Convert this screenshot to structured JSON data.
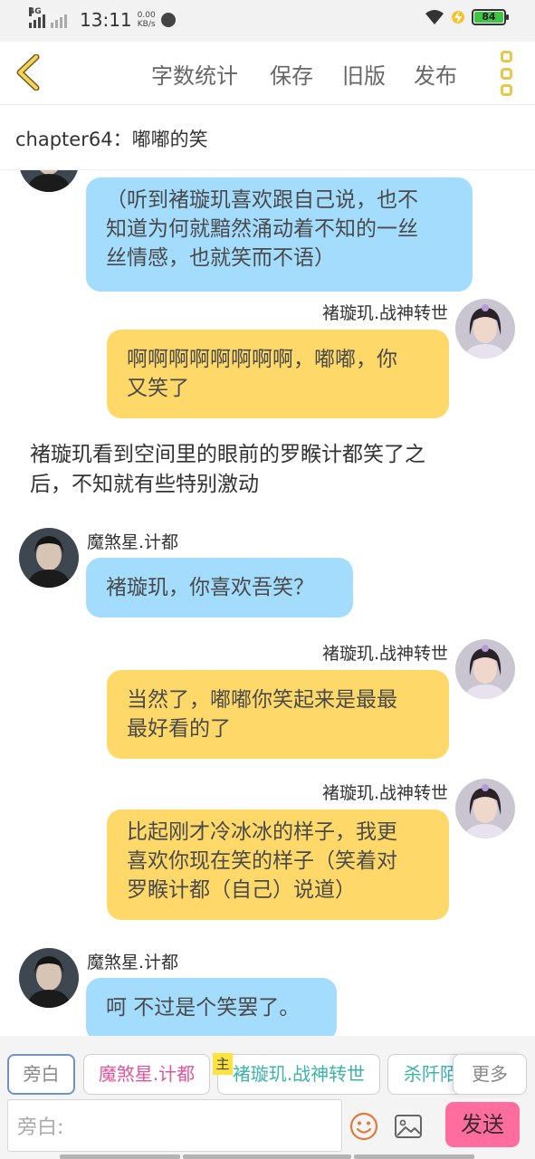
{
  "status_bar": {
    "network": "4G",
    "time": "13:11",
    "speed_value": "0.00",
    "speed_unit": "KB/s",
    "battery": "84"
  },
  "header": {
    "back_icon": "chevron-left-icon",
    "word_count": "字数统计",
    "save": "保存",
    "old_version": "旧版",
    "publish": "发布",
    "more_icon": "more-vertical-icon",
    "accent_color": "#e5c74a"
  },
  "chapter": {
    "title": "chapter64：嘟嘟的笑"
  },
  "colors": {
    "left_bubble": "#a3dcfc",
    "right_bubble": "#fed969",
    "send_button": "#fe6d9d"
  },
  "messages": [
    {
      "side": "left",
      "name": "",
      "avatar": "male-avatar",
      "lines": [
        "（听到褚璇玑喜欢跟自己说，也不",
        "知道为何就黯然涌动着不知的一丝",
        "丝情感，也就笑而不语）"
      ]
    },
    {
      "side": "right",
      "name": "褚璇玑.战神转世",
      "avatar": "female-avatar",
      "lines": [
        "啊啊啊啊啊啊啊啊，嘟嘟，你",
        "又笑了"
      ]
    },
    {
      "side": "narration",
      "lines": [
        "褚璇玑看到空间里的眼前的罗睺计都笑了之",
        "后，不知就有些特别激动"
      ]
    },
    {
      "side": "left",
      "name": "魔煞星.计都",
      "avatar": "male-avatar",
      "lines": [
        "褚璇玑，你喜欢吾笑？"
      ]
    },
    {
      "side": "right",
      "name": "褚璇玑.战神转世",
      "avatar": "female-avatar",
      "lines": [
        "当然了，嘟嘟你笑起来是最最",
        "最好看的了"
      ]
    },
    {
      "side": "right",
      "name": "褚璇玑.战神转世",
      "avatar": "female-avatar",
      "lines": [
        "比起刚才冷冰冰的样子，我更",
        "喜欢你现在笑的样子（笑着对",
        "罗睺计都（自己）说道）"
      ]
    },
    {
      "side": "left",
      "name": "魔煞星.计都",
      "avatar": "male-avatar",
      "lines": [
        "呵 不过是个笑罢了。"
      ]
    }
  ],
  "roles": [
    {
      "label": "旁白",
      "color": "#999999",
      "active": true
    },
    {
      "label": "魔煞星.计都",
      "color": "#e0559a",
      "active": false
    },
    {
      "label": "褚璇玑.战神转世",
      "color": "#3db3a8",
      "active": false,
      "tag": "主"
    },
    {
      "label": "杀阡陌",
      "color": "#3db3a8",
      "active": false
    },
    {
      "label": "更多",
      "color": "#888888",
      "active": false
    }
  ],
  "composer": {
    "placeholder": "旁白:",
    "emoji_icon": "smiley-icon",
    "image_icon": "image-icon",
    "send": "发送"
  }
}
